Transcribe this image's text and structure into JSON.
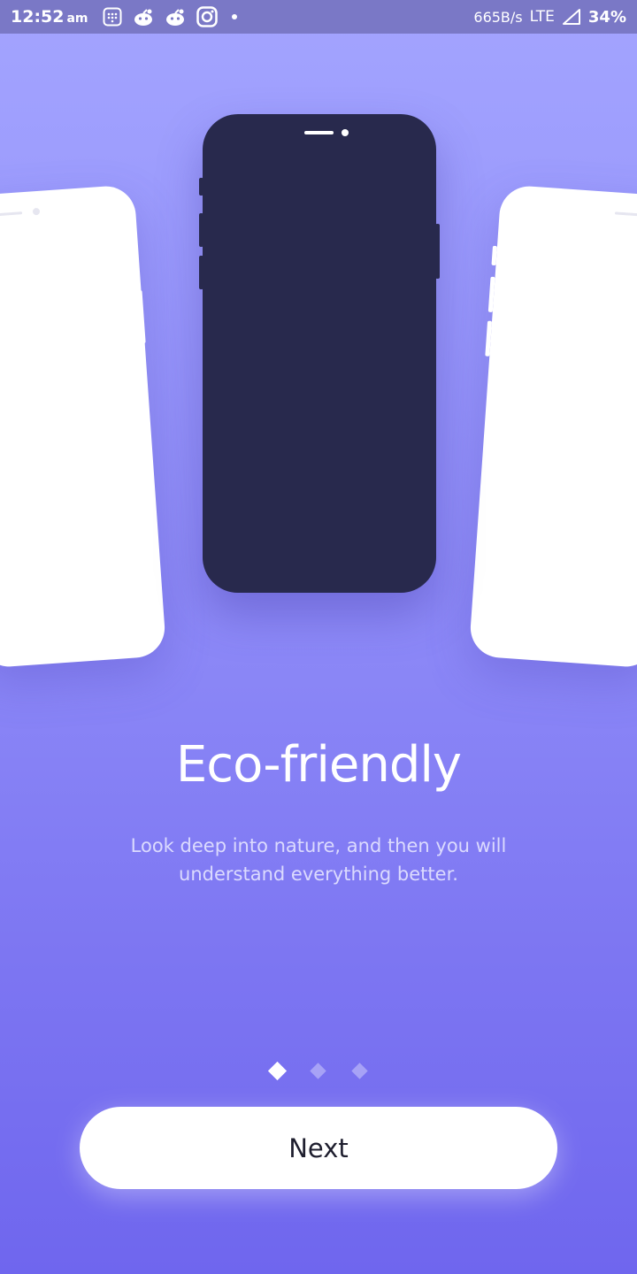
{
  "status_bar": {
    "time": "12:52",
    "ampm": "am",
    "network_speed": "665B/s",
    "network_type": "LTE",
    "battery": "34%",
    "icons": [
      "calculator-icon",
      "reddit-icon",
      "reddit-icon",
      "instagram-icon",
      "dot-icon",
      "signal-icon"
    ]
  },
  "onboarding": {
    "title": "Eco-friendly",
    "subtitle": "Look deep into nature, and then you will understand everything better.",
    "page_indicator": {
      "current": 1,
      "total": 3
    },
    "next_label": "Next"
  },
  "colors": {
    "background_top": "#a3a4ff",
    "background_bottom": "#6f66ee",
    "phone_dark": "#28294d",
    "phone_light": "#ffffff"
  }
}
